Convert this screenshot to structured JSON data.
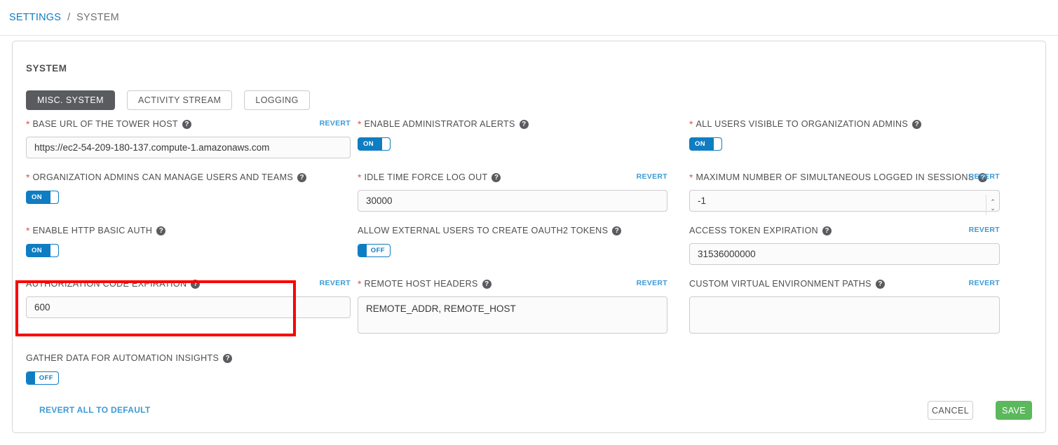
{
  "breadcrumb": {
    "parent": "SETTINGS",
    "separator": "/",
    "current": "SYSTEM"
  },
  "card": {
    "title": "SYSTEM"
  },
  "tabs": [
    {
      "label": "MISC. SYSTEM",
      "active": true
    },
    {
      "label": "ACTIVITY STREAM",
      "active": false
    },
    {
      "label": "LOGGING",
      "active": false
    }
  ],
  "icons": {
    "help": "?",
    "spinner_up": "⌃",
    "spinner_down": "⌄"
  },
  "labels": {
    "revert": "REVERT",
    "revert_all": "REVERT ALL TO DEFAULT"
  },
  "fields": {
    "base_url": {
      "label": "BASE URL OF THE TOWER HOST",
      "required": true,
      "revert": "REVERT",
      "value": "https://ec2-54-209-180-137.compute-1.amazonaws.com"
    },
    "org_admins_manage": {
      "label": "ORGANIZATION ADMINS CAN MANAGE USERS AND TEAMS",
      "required": true,
      "state": "ON"
    },
    "http_basic_auth": {
      "label": "ENABLE HTTP BASIC AUTH",
      "required": true,
      "state": "ON"
    },
    "auth_code_expiration": {
      "label": "AUTHORIZATION CODE EXPIRATION",
      "required": false,
      "revert": "REVERT",
      "value": "600"
    },
    "gather_insights": {
      "label": "GATHER DATA FOR AUTOMATION INSIGHTS",
      "required": false,
      "state": "OFF"
    },
    "admin_alerts": {
      "label": "ENABLE ADMINISTRATOR ALERTS",
      "required": true,
      "state": "ON"
    },
    "idle_time": {
      "label": "IDLE TIME FORCE LOG OUT",
      "required": true,
      "revert": "REVERT",
      "value": "30000"
    },
    "external_oauth2": {
      "label": "ALLOW EXTERNAL USERS TO CREATE OAUTH2 TOKENS",
      "required": false,
      "state": "OFF"
    },
    "remote_host_headers": {
      "label": "REMOTE HOST HEADERS",
      "required": true,
      "revert": "REVERT",
      "value": "REMOTE_ADDR, REMOTE_HOST"
    },
    "all_users_visible": {
      "label": "ALL USERS VISIBLE TO ORGANIZATION ADMINS",
      "required": true,
      "state": "ON"
    },
    "max_sessions": {
      "label": "MAXIMUM NUMBER OF SIMULTANEOUS LOGGED IN SESSIONS",
      "required": true,
      "revert": "REVERT",
      "value": "-1"
    },
    "access_token_expiration": {
      "label": "ACCESS TOKEN EXPIRATION",
      "required": false,
      "revert": "REVERT",
      "value": "31536000000"
    },
    "custom_venv_paths": {
      "label": "CUSTOM VIRTUAL ENVIRONMENT PATHS",
      "required": false,
      "revert": "REVERT",
      "value": ""
    }
  },
  "footer": {
    "cancel": "CANCEL",
    "save": "SAVE"
  },
  "colors": {
    "link": "#0f7dc2",
    "revert_link": "#3c9ad4",
    "toggle_on": "#0f7dc2",
    "save_green": "#5cb85c",
    "tab_active": "#5a5b5e",
    "required_star": "#d9534f",
    "highlight": "#fa0000"
  }
}
